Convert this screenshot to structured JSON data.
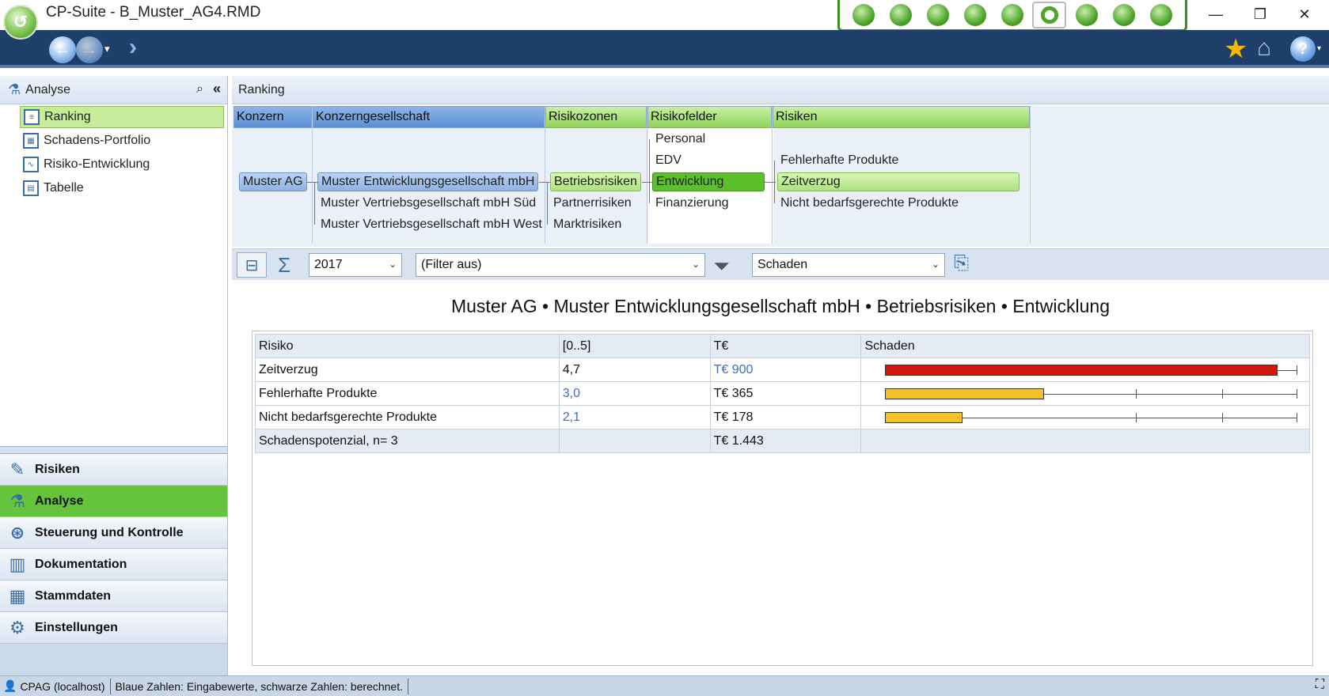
{
  "window": {
    "title": "CP-Suite - B_Muster_AG4.RMD",
    "minimize": "—",
    "restore": "❐",
    "close": "✕",
    "module_icons": [
      "dashboard-icon",
      "virus-icon",
      "leaf-icon",
      "money-icon",
      "globe-icon",
      "lifebuoy-icon",
      "gears-icon",
      "compass-icon",
      "user-doc-icon"
    ],
    "accent_color": "#3d8f22"
  },
  "navbar": {
    "back_icon": "back-arrow-icon",
    "forward_icon": "forward-arrow-icon",
    "history_caret": "▾",
    "jump_icon": "double-chevron-icon",
    "star_icon": "★",
    "home_icon": "⌂",
    "help_icon": "?",
    "help_caret": "▾",
    "bg_color": "#1f3f6b"
  },
  "sidebar": {
    "header": "Analyse",
    "search_icon": "⌕",
    "collapse_icon": "«",
    "tree": [
      {
        "label": "Ranking",
        "icon": "ranking-icon",
        "selected": true
      },
      {
        "label": "Schadens-Portfolio",
        "icon": "portfolio-icon",
        "selected": false
      },
      {
        "label": "Risiko-Entwicklung",
        "icon": "chart-line-icon",
        "selected": false
      },
      {
        "label": "Tabelle",
        "icon": "table-icon",
        "selected": false
      }
    ],
    "sections": [
      {
        "label": "Risiken",
        "icon": "pencil-icon",
        "active": false
      },
      {
        "label": "Analyse",
        "icon": "flask-icon",
        "active": true
      },
      {
        "label": "Steuerung und Kontrolle",
        "icon": "steering-icon",
        "active": false
      },
      {
        "label": "Dokumentation",
        "icon": "binder-icon",
        "active": false
      },
      {
        "label": "Stammdaten",
        "icon": "master-data-icon",
        "active": false
      },
      {
        "label": "Einstellungen",
        "icon": "gear-icon",
        "active": false
      }
    ]
  },
  "main": {
    "header": "Ranking",
    "hierarchy": {
      "columns": [
        "Konzern",
        "Konzerngesellschaft",
        "Risikozonen",
        "Risikofelder",
        "Risiken"
      ],
      "konzern": [
        "Muster AG"
      ],
      "gesellschaften": [
        "Muster Entwicklungsgesellschaft mbH",
        "Muster Vertriebsgesellschaft mbH Süd",
        "Muster Vertriebsgesellschaft mbH West"
      ],
      "zonen": [
        "Betriebsrisiken",
        "Partnerrisiken",
        "Marktrisiken"
      ],
      "felder": [
        "Personal",
        "EDV",
        "Entwicklung",
        "Finanzierung"
      ],
      "risiken": [
        "Fehlerhafte Produkte",
        "Zeitverzug",
        "Nicht bedarfsgerechte Produkte"
      ]
    },
    "filterbar": {
      "year": "2017",
      "filter": "(Filter aus)",
      "measure": "Schaden",
      "caret": "⌄"
    },
    "report": {
      "title": "Muster AG • Muster Entwicklungsgesellschaft mbH • Betriebsrisiken • Entwicklung",
      "columns": [
        "Risiko",
        "[0..5]",
        "T€",
        "Schaden"
      ],
      "rows": [
        {
          "risiko": "Zeitverzug",
          "score": "4,7",
          "score_input": false,
          "amount": "T€ 900",
          "amount_input": true,
          "bar_value": 900,
          "bar_color": "#d0190e"
        },
        {
          "risiko": "Fehlerhafte Produkte",
          "score": "3,0",
          "score_input": true,
          "amount": "T€ 365",
          "amount_input": false,
          "bar_value": 365,
          "bar_color": "#f5c02a"
        },
        {
          "risiko": "Nicht bedarfsgerechte Produkte",
          "score": "2,1",
          "score_input": true,
          "amount": "T€ 178",
          "amount_input": false,
          "bar_value": 178,
          "bar_color": "#f5c02a"
        }
      ],
      "summary": {
        "label": "Schadenspotenzial, n= 3",
        "amount": "T€ 1.443"
      }
    }
  },
  "status": {
    "connection": "CPAG (localhost)",
    "message": "Blaue Zahlen: Eingabewerte, schwarze Zahlen: berechnet."
  }
}
